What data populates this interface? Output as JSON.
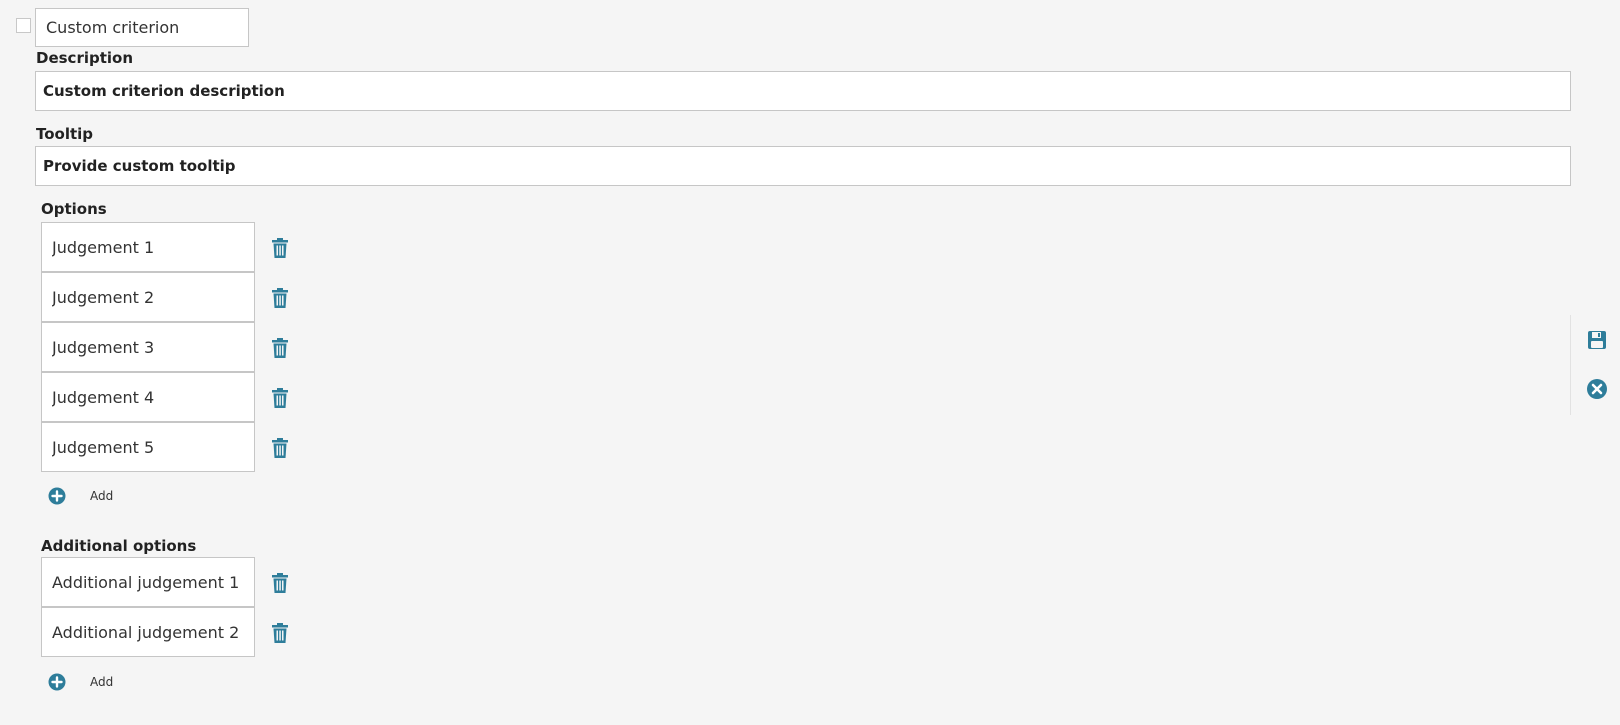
{
  "criterion": {
    "name_value": "Custom criterion",
    "checked": false
  },
  "description": {
    "label": "Description",
    "value": "Custom criterion description"
  },
  "tooltip": {
    "label": "Tooltip",
    "value": "Provide custom tooltip"
  },
  "options": {
    "label": "Options",
    "items": [
      {
        "value": "Judgement 1"
      },
      {
        "value": "Judgement 2"
      },
      {
        "value": "Judgement 3"
      },
      {
        "value": "Judgement 4"
      },
      {
        "value": "Judgement 5"
      }
    ],
    "add_label": "Add"
  },
  "additional_options": {
    "label": "Additional options",
    "items": [
      {
        "value": "Additional judgement 1"
      },
      {
        "value": "Additional judgement 2"
      }
    ],
    "add_label": "Add"
  },
  "icons": {
    "delete": "trash-icon",
    "add": "plus-circle-icon",
    "save": "floppy-disk-icon",
    "cancel": "close-circle-icon"
  },
  "colors": {
    "accent": "#2e7d9a",
    "background": "#f5f5f5",
    "border": "#c6c6c6"
  }
}
